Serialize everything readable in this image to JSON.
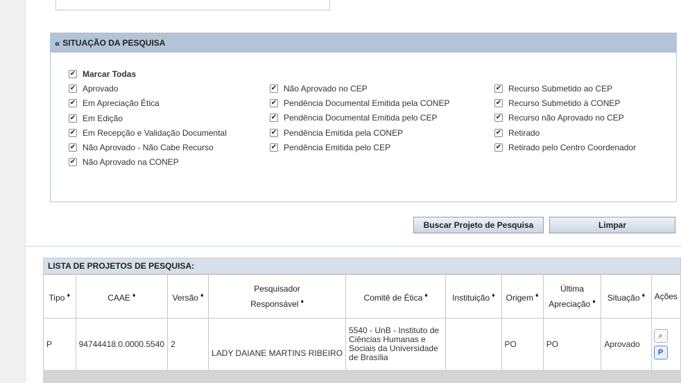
{
  "filter": {
    "title": "SITUAÇÃO DA PESQUISA",
    "collapse_glyph": "«",
    "check_glyph": "✔",
    "mark_all": "Marcar Todas",
    "col1": [
      "Aprovado",
      "Em Apreciação Ética",
      "Em Edição",
      "Em Recepção e Validação Documental",
      "Não Aprovado - Não Cabe Recurso",
      "Não Aprovado na CONEP"
    ],
    "col2": [
      "Não Aprovado no CEP",
      "Pendência Documental Emitida pela CONEP",
      "Pendência Documental Emitida pelo CEP",
      "Pendência Emitida pela CONEP",
      "Pendência Emitida pelo CEP"
    ],
    "col3": [
      "Recurso Submetido ao CEP",
      "Recurso Submetido à CONEP",
      "Recurso não Aprovado no CEP",
      "Retirado",
      "Retirado pelo Centro Coordenador"
    ]
  },
  "buttons": {
    "search": "Buscar Projeto de Pesquisa",
    "clear": "Limpar"
  },
  "list": {
    "title": "LISTA DE PROJETOS DE PESQUISA:",
    "sort_glyph": "♦",
    "headers": {
      "tipo": "Tipo",
      "caae": "CAAE",
      "versao": "Versão",
      "pesq_1": "Pesquisador",
      "pesq_2": "Responsável",
      "comite": "Comitê de Ética",
      "instituicao": "Instituição",
      "origem": "Origem",
      "ultima_1": "Última",
      "ultima_2": "Apreciação",
      "situacao": "Situação",
      "acoes": "Ações"
    },
    "rows": [
      {
        "tipo": "P",
        "caae": "94744418.0.0000.5540",
        "versao": "2",
        "pesquisador": "LADY DAIANE MARTINS RIBEIRO",
        "comite": "5540 - UnB - Instituto de Ciências Humanas e Sociais da Universidade de Brasília",
        "instituicao": "",
        "origem": "PO",
        "ultima": "PO",
        "situacao": "Aprovado",
        "actions": [
          "magnifier-icon",
          "document-arrow-icon"
        ]
      }
    ]
  },
  "colors": {
    "panel_header": "#b2c4d5",
    "list_header": "#d6e0e9"
  }
}
